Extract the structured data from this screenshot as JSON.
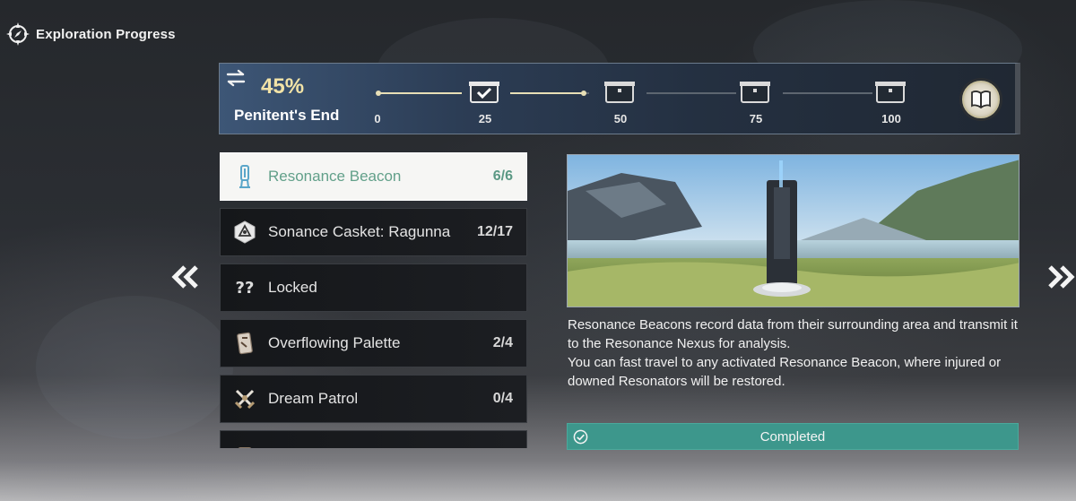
{
  "header": {
    "title": "Exploration Progress",
    "icon": "compass-icon"
  },
  "banner": {
    "percent": "45%",
    "region": "Penitent's End",
    "progress": 0.45,
    "milestones": [
      {
        "label": "0",
        "claimed": true
      },
      {
        "label": "25",
        "claimed": true,
        "icon": "chest-checked-icon"
      },
      {
        "label": "50",
        "claimed": false,
        "icon": "chest-icon"
      },
      {
        "label": "75",
        "claimed": false,
        "icon": "chest-icon"
      },
      {
        "label": "100",
        "claimed": false,
        "icon": "chest-icon"
      }
    ],
    "final_reward_icon": "book-icon"
  },
  "nav": {
    "prev_icon": "double-chevron-left-icon",
    "next_icon": "double-chevron-right-icon"
  },
  "categories": [
    {
      "label": "Resonance Beacon",
      "count": "6/6",
      "active": true,
      "icon": "beacon-icon"
    },
    {
      "label": "Sonance Casket: Ragunna",
      "count": "12/17",
      "active": false,
      "icon": "casket-icon"
    },
    {
      "label": "Locked",
      "count": "",
      "active": false,
      "icon_text": "??"
    },
    {
      "label": "Overflowing Palette",
      "count": "2/4",
      "active": false,
      "icon": "palette-icon"
    },
    {
      "label": "Dream Patrol",
      "count": "0/4",
      "active": false,
      "icon": "crossed-swords-icon"
    }
  ],
  "detail": {
    "description_1": "Resonance Beacons record data from their surrounding area and transmit it to the Resonance Nexus for analysis.",
    "description_2": "You can fast travel to any activated Resonance Beacon, where injured or downed Resonators will be restored.",
    "status": "Completed"
  },
  "colors": {
    "accent_teal": "#3d978c",
    "active_text": "#62a08a",
    "percent_gold": "#f2e3a7"
  }
}
